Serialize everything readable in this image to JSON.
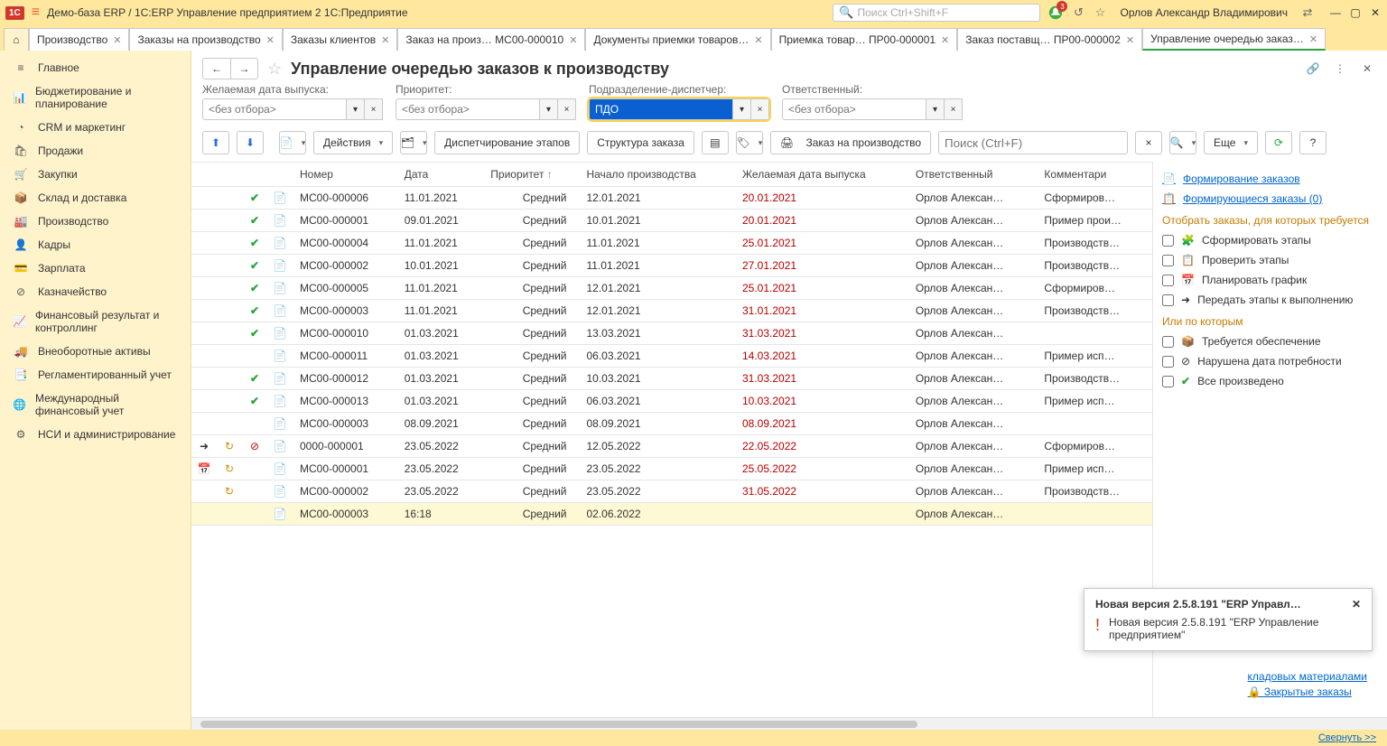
{
  "title_bar": {
    "app_title": "Демо-база ERP / 1С:ERP Управление предприятием 2 1С:Предприятие",
    "search_placeholder": "Поиск Ctrl+Shift+F",
    "notif_count": "3",
    "user": "Орлов Александр Владимирович"
  },
  "tabs": [
    {
      "label": "Производство",
      "closable": true
    },
    {
      "label": "Заказы на производство",
      "closable": true
    },
    {
      "label": "Заказы клиентов",
      "closable": true
    },
    {
      "label": "Заказ на произ… МС00-000010",
      "closable": true
    },
    {
      "label": "Документы приемки товаров…",
      "closable": true
    },
    {
      "label": "Приемка товар… ПР00-000001",
      "closable": true
    },
    {
      "label": "Заказ поставщ… ПР00-000002",
      "closable": true
    },
    {
      "label": "Управление очередью заказ…",
      "closable": true,
      "active": true
    }
  ],
  "sidebar": [
    {
      "icon": "≡",
      "label": "Главное"
    },
    {
      "icon": "📊",
      "label": "Бюджетирование и планирование"
    },
    {
      "icon": "◔",
      "label": "CRM и маркетинг"
    },
    {
      "icon": "🛍",
      "label": "Продажи"
    },
    {
      "icon": "🛒",
      "label": "Закупки"
    },
    {
      "icon": "📦",
      "label": "Склад и доставка"
    },
    {
      "icon": "🏭",
      "label": "Производство"
    },
    {
      "icon": "👤",
      "label": "Кадры"
    },
    {
      "icon": "💳",
      "label": "Зарплата"
    },
    {
      "icon": "⊘",
      "label": "Казначейство"
    },
    {
      "icon": "📈",
      "label": "Финансовый результат и контроллинг"
    },
    {
      "icon": "🚚",
      "label": "Внеоборотные активы"
    },
    {
      "icon": "📑",
      "label": "Регламентированный учет"
    },
    {
      "icon": "🌐",
      "label": "Международный финансовый учет"
    },
    {
      "icon": "⚙",
      "label": "НСИ и администрирование"
    }
  ],
  "page": {
    "title": "Управление очередью заказов к производству"
  },
  "filters": {
    "date": {
      "label": "Желаемая дата выпуска:",
      "placeholder": "<без отбора>",
      "value": ""
    },
    "priority": {
      "label": "Приоритет:",
      "placeholder": "<без отбора>",
      "value": ""
    },
    "unit": {
      "label": "Подразделение-диспетчер:",
      "placeholder": "",
      "value": "ПДО"
    },
    "resp": {
      "label": "Ответственный:",
      "placeholder": "<без отбора>",
      "value": ""
    }
  },
  "toolbar": {
    "actions": "Действия",
    "dispatch": "Диспетчирование этапов",
    "structure": "Структура заказа",
    "new_order": "Заказ на производство",
    "table_search": "Поиск (Ctrl+F)",
    "more": "Еще"
  },
  "columns": [
    "",
    "",
    "",
    "",
    "Номер",
    "Дата",
    "Приоритет",
    "Начало производства",
    "Желаемая дата выпуска",
    "Ответственный",
    "Комментари"
  ],
  "rows": [
    {
      "c1": "",
      "c2": "",
      "c3": "✔",
      "c4": "doc",
      "num": "МС00-000006",
      "date": "11.01.2021",
      "prio": "Средний",
      "start": "12.01.2021",
      "due": "20.01.2021",
      "due_red": true,
      "resp": "Орлов Алексан…",
      "comment": "Сформиров…"
    },
    {
      "c1": "",
      "c2": "",
      "c3": "✔",
      "c4": "doc",
      "num": "МС00-000001",
      "date": "09.01.2021",
      "prio": "Средний",
      "start": "10.01.2021",
      "due": "20.01.2021",
      "due_red": true,
      "resp": "Орлов Алексан…",
      "comment": "Пример прои…"
    },
    {
      "c1": "",
      "c2": "",
      "c3": "✔",
      "c4": "doc",
      "num": "МС00-000004",
      "date": "11.01.2021",
      "prio": "Средний",
      "start": "11.01.2021",
      "due": "25.01.2021",
      "due_red": true,
      "resp": "Орлов Алексан…",
      "comment": "Производств…"
    },
    {
      "c1": "",
      "c2": "",
      "c3": "✔",
      "c4": "doc",
      "num": "МС00-000002",
      "date": "10.01.2021",
      "prio": "Средний",
      "start": "11.01.2021",
      "due": "27.01.2021",
      "due_red": true,
      "resp": "Орлов Алексан…",
      "comment": "Производств…"
    },
    {
      "c1": "",
      "c2": "",
      "c3": "✔",
      "c4": "doc",
      "num": "МС00-000005",
      "date": "11.01.2021",
      "prio": "Средний",
      "start": "12.01.2021",
      "due": "25.01.2021",
      "due_red": true,
      "resp": "Орлов Алексан…",
      "comment": "Сформиров…"
    },
    {
      "c1": "",
      "c2": "",
      "c3": "✔",
      "c4": "doc",
      "num": "МС00-000003",
      "date": "11.01.2021",
      "prio": "Средний",
      "start": "12.01.2021",
      "due": "31.01.2021",
      "due_red": true,
      "resp": "Орлов Алексан…",
      "comment": "Производств…"
    },
    {
      "c1": "",
      "c2": "",
      "c3": "✔",
      "c4": "doc",
      "num": "МС00-000010",
      "date": "01.03.2021",
      "prio": "Средний",
      "start": "13.03.2021",
      "due": "31.03.2021",
      "due_red": true,
      "resp": "Орлов Алексан…",
      "comment": ""
    },
    {
      "c1": "",
      "c2": "",
      "c3": "",
      "c4": "doc",
      "num": "МС00-000011",
      "date": "01.03.2021",
      "prio": "Средний",
      "start": "06.03.2021",
      "due": "14.03.2021",
      "due_red": true,
      "resp": "Орлов Алексан…",
      "comment": "Пример исп…"
    },
    {
      "c1": "",
      "c2": "",
      "c3": "✔",
      "c4": "doc",
      "num": "МС00-000012",
      "date": "01.03.2021",
      "prio": "Средний",
      "start": "10.03.2021",
      "due": "31.03.2021",
      "due_red": true,
      "resp": "Орлов Алексан…",
      "comment": "Производств…"
    },
    {
      "c1": "",
      "c2": "",
      "c3": "✔",
      "c4": "doc",
      "num": "МС00-000013",
      "date": "01.03.2021",
      "prio": "Средний",
      "start": "06.03.2021",
      "due": "10.03.2021",
      "due_red": true,
      "resp": "Орлов Алексан…",
      "comment": "Пример исп…"
    },
    {
      "c1": "",
      "c2": "",
      "c3": "",
      "c4": "doc",
      "num": "МС00-000003",
      "date": "08.09.2021",
      "prio": "Средний",
      "start": "08.09.2021",
      "due": "08.09.2021",
      "due_red": true,
      "resp": "Орлов Алексан…",
      "comment": ""
    },
    {
      "c1": "➜",
      "c2": "↻",
      "c3": "⊘",
      "c4": "doc",
      "num": "0000-000001",
      "date": "23.05.2022",
      "prio": "Средний",
      "start": "12.05.2022",
      "due": "22.05.2022",
      "due_red": true,
      "resp": "Орлов Алексан…",
      "comment": "Сформиров…"
    },
    {
      "c1": "📅",
      "c2": "↻",
      "c3": "",
      "c4": "doc",
      "num": "МС00-000001",
      "date": "23.05.2022",
      "prio": "Средний",
      "start": "23.05.2022",
      "due": "25.05.2022",
      "due_red": true,
      "resp": "Орлов Алексан…",
      "comment": "Пример исп…"
    },
    {
      "c1": "",
      "c2": "↻",
      "c3": "",
      "c4": "doc",
      "num": "МС00-000002",
      "date": "23.05.2022",
      "prio": "Средний",
      "start": "23.05.2022",
      "due": "31.05.2022",
      "due_red": true,
      "resp": "Орлов Алексан…",
      "comment": "Производств…"
    },
    {
      "c1": "",
      "c2": "",
      "c3": "",
      "c4": "doc",
      "num": "МС00-000003",
      "date": "16:18",
      "prio": "Средний",
      "start": "02.06.2022",
      "due": "",
      "due_red": false,
      "resp": "Орлов Алексан…",
      "comment": "",
      "sel": true
    }
  ],
  "side_panel": {
    "link1": "Формирование заказов",
    "link2": "Формирующиеся заказы (0)",
    "hdr1": "Отобрать заказы, для которых требуется",
    "opt1": "Сформировать этапы",
    "opt2": "Проверить этапы",
    "opt3": "Планировать график",
    "opt4": "Передать этапы к выполнению",
    "hdr2": "Или по которым",
    "opt5": "Требуется обеспечение",
    "opt6": "Нарушена дата потребности",
    "opt7": "Все произведено"
  },
  "extra": {
    "l1": "кладовых материалами",
    "l2": "Закрытые заказы"
  },
  "notification": {
    "title": "Новая версия 2.5.8.191 \"ERP Управл…",
    "body": "Новая версия 2.5.8.191 \"ERP Управление предприятием\""
  },
  "statusbar": {
    "collapse": "Свернуть >>"
  }
}
